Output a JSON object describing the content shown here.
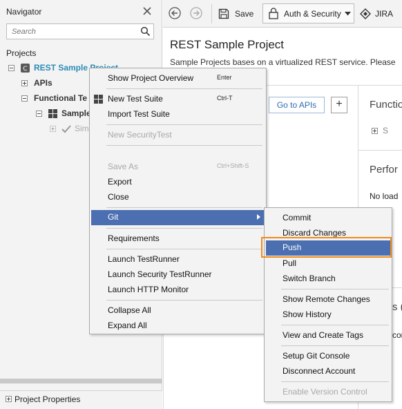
{
  "navigator": {
    "title": "Navigator",
    "search_placeholder": "Search",
    "projects_label": "Projects",
    "tree": {
      "project": "REST Sample Project",
      "apis": "APIs",
      "functional_tests": "Functional Te",
      "sample_suite": "Sample",
      "simple_case": "Sim"
    },
    "footer": "Project Properties"
  },
  "toolbar": {
    "save_label": "Save",
    "auth_label": "Auth & Security",
    "jira_label": "JIRA"
  },
  "main": {
    "project_title": "REST Sample Project",
    "project_description": "Sample Projects bases on a virtualized REST service. Please",
    "goto_apis": "Go to APIs",
    "add_label": "+",
    "side_functional": "Functio",
    "side_functional_item": "S",
    "side_performance": "Perfor",
    "side_no_load": "No load",
    "side_security": "s (V",
    "side_security_text": "con"
  },
  "context_menu": {
    "items": [
      {
        "label": "Show Project Overview",
        "shortcut": "Enter"
      },
      {
        "label": "New Test Suite",
        "shortcut": "Ctrl-T"
      },
      {
        "label": "Import Test Suite",
        "shortcut": ""
      },
      {
        "label": "New SecurityTest",
        "shortcut": ""
      },
      {
        "label": "Save As",
        "shortcut": "Ctrl+Shift-S"
      },
      {
        "label": "Export",
        "shortcut": ""
      },
      {
        "label": "Close",
        "shortcut": ""
      },
      {
        "label": "Git",
        "shortcut": ""
      },
      {
        "label": "Requirements",
        "shortcut": ""
      },
      {
        "label": "Launch TestRunner",
        "shortcut": ""
      },
      {
        "label": "Launch Security TestRunner",
        "shortcut": ""
      },
      {
        "label": "Launch HTTP Monitor",
        "shortcut": ""
      },
      {
        "label": "Collapse All",
        "shortcut": ""
      },
      {
        "label": "Expand All",
        "shortcut": ""
      }
    ]
  },
  "git_submenu": {
    "items": [
      {
        "label": "Commit"
      },
      {
        "label": "Discard Changes"
      },
      {
        "label": "Push"
      },
      {
        "label": "Pull"
      },
      {
        "label": "Switch Branch"
      },
      {
        "label": "Show Remote Changes"
      },
      {
        "label": "Show History"
      },
      {
        "label": "View and Create Tags"
      },
      {
        "label": "Setup Git Console"
      },
      {
        "label": "Disconnect Account"
      },
      {
        "label": "Enable Version Control"
      }
    ]
  },
  "colors": {
    "menu_highlight": "#4b6fb0",
    "push_outline": "#f08a1c",
    "project_link": "#2a8bb5"
  }
}
